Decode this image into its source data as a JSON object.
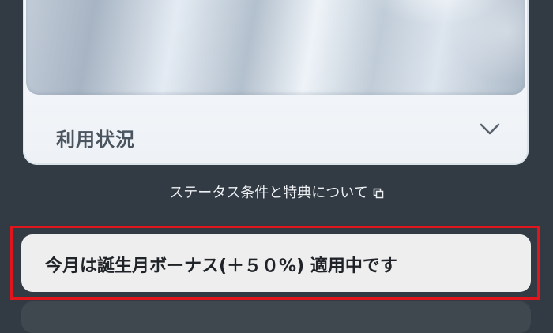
{
  "card": {
    "usage_label": "利用状況"
  },
  "status_link": {
    "label": "ステータス条件と特典について",
    "icon": "external-link-icon"
  },
  "banner": {
    "text": "今月は誕生月ボーナス(＋５０%) 適用中です"
  },
  "colors": {
    "background": "#323a43",
    "highlight": "#e0161c",
    "banner_bg": "#eeeeee"
  }
}
